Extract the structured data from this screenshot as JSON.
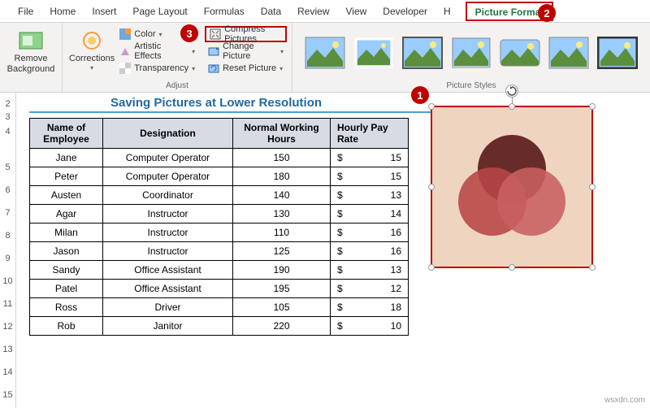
{
  "tabs": [
    "File",
    "Home",
    "Insert",
    "Page Layout",
    "Formulas",
    "Data",
    "Review",
    "View",
    "Developer",
    "H"
  ],
  "active_tab": "Picture Format",
  "ribbon": {
    "remove_bg": "Remove\nBackground",
    "corrections": "Corrections",
    "color": "Color",
    "artistic": "Artistic Effects",
    "transparency": "Transparency",
    "compress": "Compress Pictures",
    "change": "Change Picture",
    "reset": "Reset Picture",
    "adjust_label": "Adjust",
    "styles_label": "Picture Styles"
  },
  "badges": {
    "b1": "1",
    "b2": "2",
    "b3": "3"
  },
  "title": "Saving Pictures at Lower Resolution",
  "headers": {
    "name": "Name of Employee",
    "desig": "Designation",
    "hours": "Normal Working Hours",
    "rate": "Hourly Pay Rate"
  },
  "rows": [
    {
      "name": "Jane",
      "desig": "Computer Operator",
      "hours": "150",
      "rate": "15"
    },
    {
      "name": "Peter",
      "desig": "Computer Operator",
      "hours": "180",
      "rate": "15"
    },
    {
      "name": "Austen",
      "desig": "Coordinator",
      "hours": "140",
      "rate": "13"
    },
    {
      "name": "Agar",
      "desig": "Instructor",
      "hours": "130",
      "rate": "14"
    },
    {
      "name": "Milan",
      "desig": "Instructor",
      "hours": "110",
      "rate": "16"
    },
    {
      "name": "Jason",
      "desig": "Instructor",
      "hours": "125",
      "rate": "16"
    },
    {
      "name": "Sandy",
      "desig": "Office Assistant",
      "hours": "190",
      "rate": "13"
    },
    {
      "name": "Patel",
      "desig": "Office Assistant",
      "hours": "195",
      "rate": "12"
    },
    {
      "name": "Ross",
      "desig": "Driver",
      "hours": "105",
      "rate": "18"
    },
    {
      "name": "Rob",
      "desig": "Janitor",
      "hours": "220",
      "rate": "10"
    }
  ],
  "currency": "$",
  "row_nums": [
    "2",
    "3",
    "4",
    "5",
    "6",
    "7",
    "8",
    "9",
    "10",
    "11",
    "12",
    "13",
    "14",
    "15"
  ],
  "watermark": "wsxdn.com"
}
